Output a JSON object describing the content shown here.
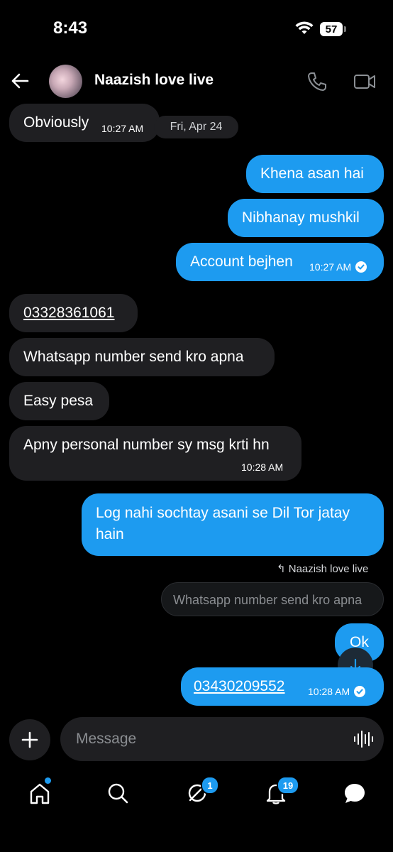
{
  "status_bar": {
    "time": "8:43",
    "battery": "57"
  },
  "header": {
    "contact_name": "Naazish love live"
  },
  "messages": [
    {
      "text": "Obviously",
      "time": "10:27 AM"
    },
    {
      "date_separator": "Fri, Apr 24"
    },
    {
      "text": "Khena asan hai"
    },
    {
      "text": "Nibhanay mushkil"
    },
    {
      "text": "Account bejhen",
      "time": "10:27 AM"
    },
    {
      "text": "03328361061"
    },
    {
      "text": "Whatsapp number send kro apna"
    },
    {
      "text": "Easy pesa"
    },
    {
      "text": "Apny personal number sy msg krti hn",
      "time": "10:28 AM"
    },
    {
      "text_line1": "Log nahi sochtay asani se Dil Tor jatay",
      "text_line2": "hain"
    },
    {
      "reply_label": "Naazish love live",
      "quoted_text": "Whatsapp number send kro apna"
    },
    {
      "text": "Ok"
    },
    {
      "text": "03430209552",
      "time": "10:28 AM"
    }
  ],
  "composer": {
    "placeholder": "Message"
  },
  "bottom_nav": {
    "messages_badge": "1",
    "notifications_badge": "19"
  },
  "colors": {
    "accent": "#1d9bf0",
    "received_bubble": "#1f1f22",
    "background": "#000000"
  }
}
